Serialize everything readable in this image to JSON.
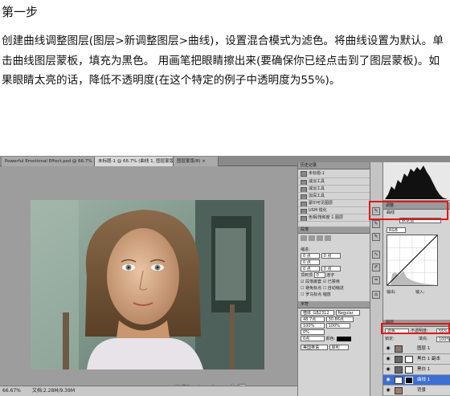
{
  "article": {
    "heading": "第一步",
    "body": "创建曲线调整图层(图层>新调整图层>曲线)，设置混合模式为滤色。将曲线设置为默认。单击曲线图层蒙板，填充为黑色。 用画笔把眼睛擦出来(要确保你已经点击到了图层蒙板)。如果眼睛太亮的话，降低不透明度(在这个特定的例子中透明度为55%)。"
  },
  "photoshop": {
    "tabs": [
      "Powerful Emotional Effect.psd @ 66.7% (Lights, 图层蒙版/8) ×",
      "未标题-1 @ 66.7% (曲线 1, 图层蒙版/8) ×",
      "图层蒙版/8) ×"
    ],
    "watermark": "@Photoshop大师",
    "status": {
      "zoom": "66.67%",
      "doc": "文档:2.28M/9.39M"
    },
    "history": {
      "title": "历史记录",
      "snapshot": "未标题-1",
      "items": [
        "减淡工具",
        "减淡工具",
        "加深工具",
        "蒙印可见图层",
        "USM 锐化",
        "色相/饱和度 1 图层"
      ]
    },
    "adjustments": {
      "title": "调整",
      "curves_label": "曲线",
      "preset": "默认值",
      "channel": "RGB",
      "output_label": "输出:",
      "input_label": "输入:"
    },
    "paragraph_panel": {
      "title": "段落",
      "indent_label": "缩进:",
      "fields": [
        "0 点",
        "0 点",
        "0 点",
        "0 点",
        "0 点"
      ],
      "zoom_label": "缩放",
      "hyphen_label": "连字",
      "top_left_label": "顶到顶",
      "top_left_value": "0",
      "checks": [
        "段落嵌套",
        "已禁用",
        "避免标点",
        "自动缩进",
        "罗马标点"
      ]
    },
    "character_panel": {
      "title": "字符",
      "font": "楷体_GB2312",
      "style": "Regular",
      "size": "48.7点",
      "leading": "30.86点",
      "tracking": "100%",
      "scale": "100%",
      "kerning": "0%",
      "baseline": "0点",
      "color_label": "颜色:",
      "language": "美国英语",
      "aa": "犀利"
    },
    "layers": {
      "title": "图层",
      "blend_mode": "滤色",
      "opacity_label": "不透明度:",
      "opacity": "55%",
      "fill_label": "填充:",
      "fill": "100%",
      "lock_label": "锁定:",
      "items": [
        {
          "name": "图层 1",
          "selected": false
        },
        {
          "name": "黑白 1 副本",
          "selected": false
        },
        {
          "name": "黑白 1",
          "selected": false
        },
        {
          "name": "曲线 1",
          "selected": true
        },
        {
          "name": "背景",
          "selected": false
        }
      ]
    }
  }
}
